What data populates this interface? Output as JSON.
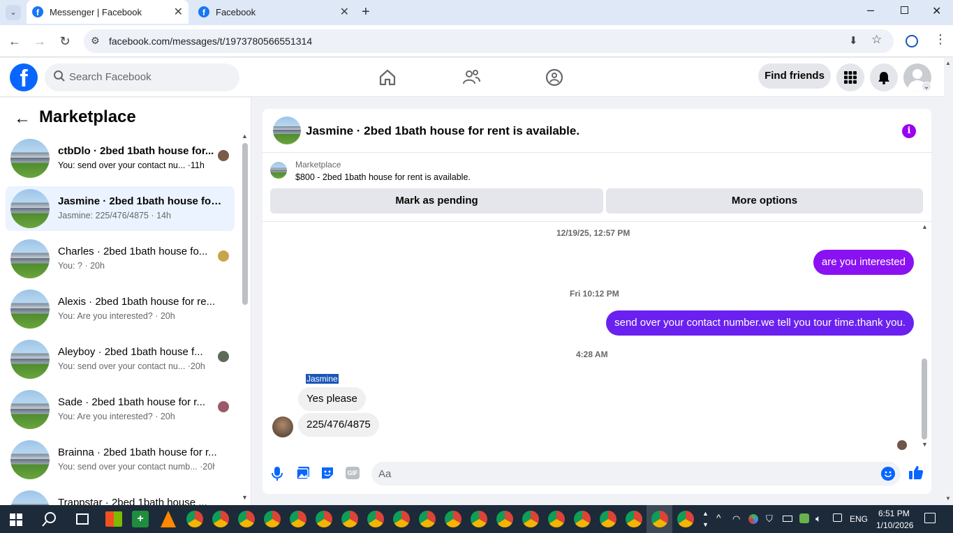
{
  "browser": {
    "tabs": [
      {
        "title": "Messenger | Facebook",
        "active": true
      },
      {
        "title": "Facebook",
        "active": false
      }
    ],
    "url": "facebook.com/messages/t/1973780566551314"
  },
  "header": {
    "search_placeholder": "Search Facebook",
    "find_friends": "Find friends"
  },
  "sidebar": {
    "title": "Marketplace",
    "conversations": [
      {
        "name": "ctbDlo · 2bed 1bath house for...",
        "snippet": "You: send over your contact nu... ·11h",
        "selected": false,
        "bold": true
      },
      {
        "name": "Jasmine · 2bed 1bath house for r...",
        "snippet": "Jasmine: 225/476/4875 · 14h",
        "selected": true,
        "bold": true
      },
      {
        "name": "Charles · 2bed 1bath house fo...",
        "snippet": "You: ? · 20h",
        "selected": false,
        "bold": false
      },
      {
        "name": "Alexis · 2bed 1bath house for re...",
        "snippet": "You: Are you interested? · 20h",
        "selected": false,
        "bold": false
      },
      {
        "name": "Aleyboy · 2bed 1bath house f...",
        "snippet": "You: send over your contact nu... ·20h",
        "selected": false,
        "bold": false
      },
      {
        "name": "Sade · 2bed 1bath house for r...",
        "snippet": "You: Are you interested? · 20h",
        "selected": false,
        "bold": false
      },
      {
        "name": "Brainna · 2bed 1bath house for r...",
        "snippet": "You: send over your contact numb... ·20h",
        "selected": false,
        "bold": false
      },
      {
        "name": "Trappstar · 2bed 1bath house ...",
        "snippet": "",
        "selected": false,
        "bold": false
      }
    ]
  },
  "chat": {
    "title": "Jasmine · 2bed 1bath house for rent is available.",
    "marketplace_label": "Marketplace",
    "listing": "$800 - 2bed 1bath house for rent is available.",
    "mark_pending": "Mark as pending",
    "more_options": "More options",
    "timestamps": [
      "12/19/25, 12:57 PM",
      "Fri 10:12 PM",
      "4:28 AM"
    ],
    "outgoing": [
      "are you interested",
      "send over your contact number.we tell you tour time.thank you."
    ],
    "sender_name": "Jasmine",
    "incoming": [
      "Yes please",
      "225/476/4875"
    ],
    "composer_placeholder": "Aa"
  },
  "taskbar": {
    "lang": "ENG",
    "time": "6:51 PM",
    "date": "1/10/2026"
  },
  "colors": {
    "fb_blue": "#0866ff",
    "outgoing_bubble_1": "#8a12f2",
    "outgoing_bubble_2": "#6a21f0",
    "accent_purple": "#9b00f2",
    "selected_bg": "#eaf3ff"
  }
}
